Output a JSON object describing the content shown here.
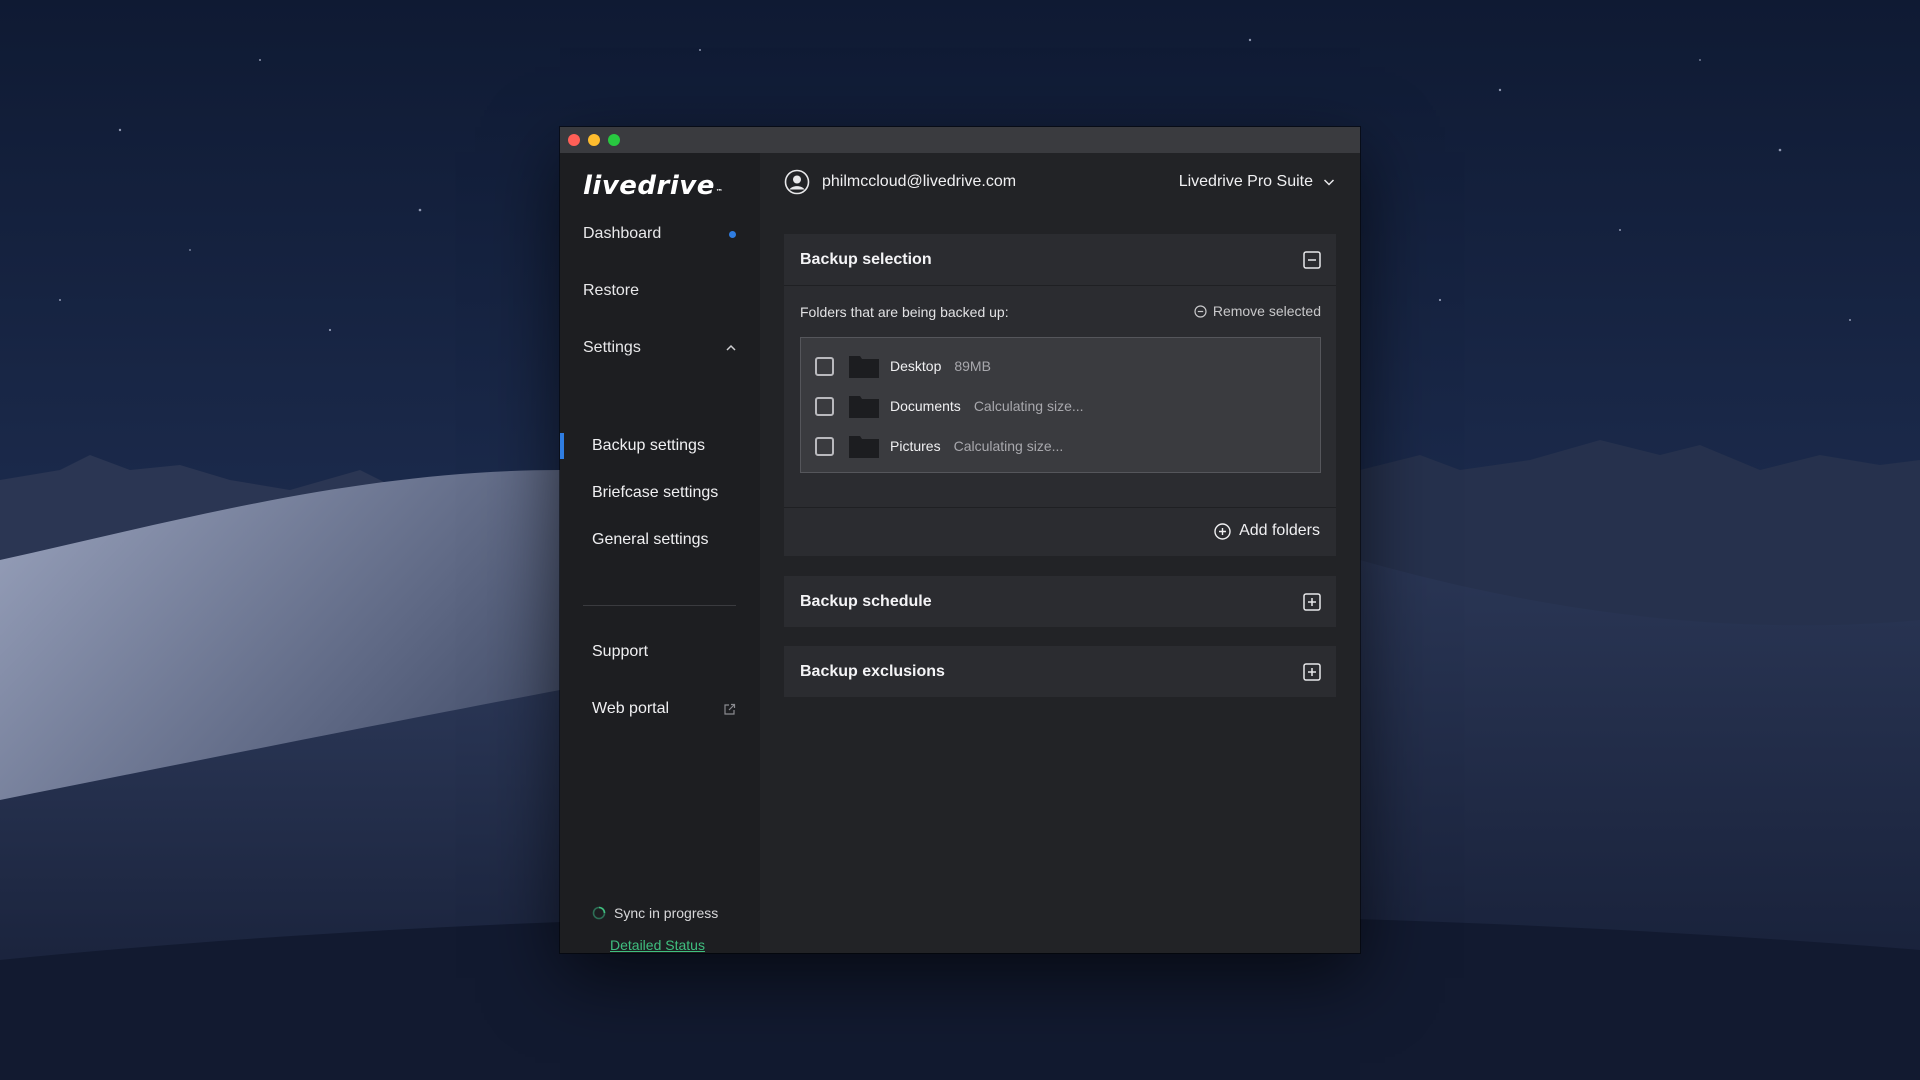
{
  "window": {
    "traffic_lights": [
      "close",
      "minimize",
      "zoom"
    ]
  },
  "sidebar": {
    "logo": "livedrive",
    "logo_mark": "™",
    "nav": {
      "dashboard": "Dashboard",
      "restore": "Restore",
      "settings": "Settings"
    },
    "settings_sub": {
      "backup": "Backup settings",
      "briefcase": "Briefcase settings",
      "general": "General settings"
    },
    "support": "Support",
    "web_portal": "Web portal",
    "status": {
      "text": "Sync in progress",
      "link": "Detailed Status"
    },
    "accent_color": "#2f7de1",
    "link_color": "#3fbf7f"
  },
  "header": {
    "email": "philmccloud@livedrive.com",
    "plan": "Livedrive Pro Suite"
  },
  "backup_selection": {
    "title": "Backup selection",
    "folders_label": "Folders that are being backed up:",
    "remove_selected": "Remove selected",
    "folders": [
      {
        "name": "Desktop",
        "size": "89MB"
      },
      {
        "name": "Documents",
        "size": "Calculating size..."
      },
      {
        "name": "Pictures",
        "size": "Calculating size..."
      }
    ],
    "add_folders": "Add folders"
  },
  "backup_schedule": {
    "title": "Backup schedule"
  },
  "backup_exclusions": {
    "title": "Backup exclusions"
  }
}
